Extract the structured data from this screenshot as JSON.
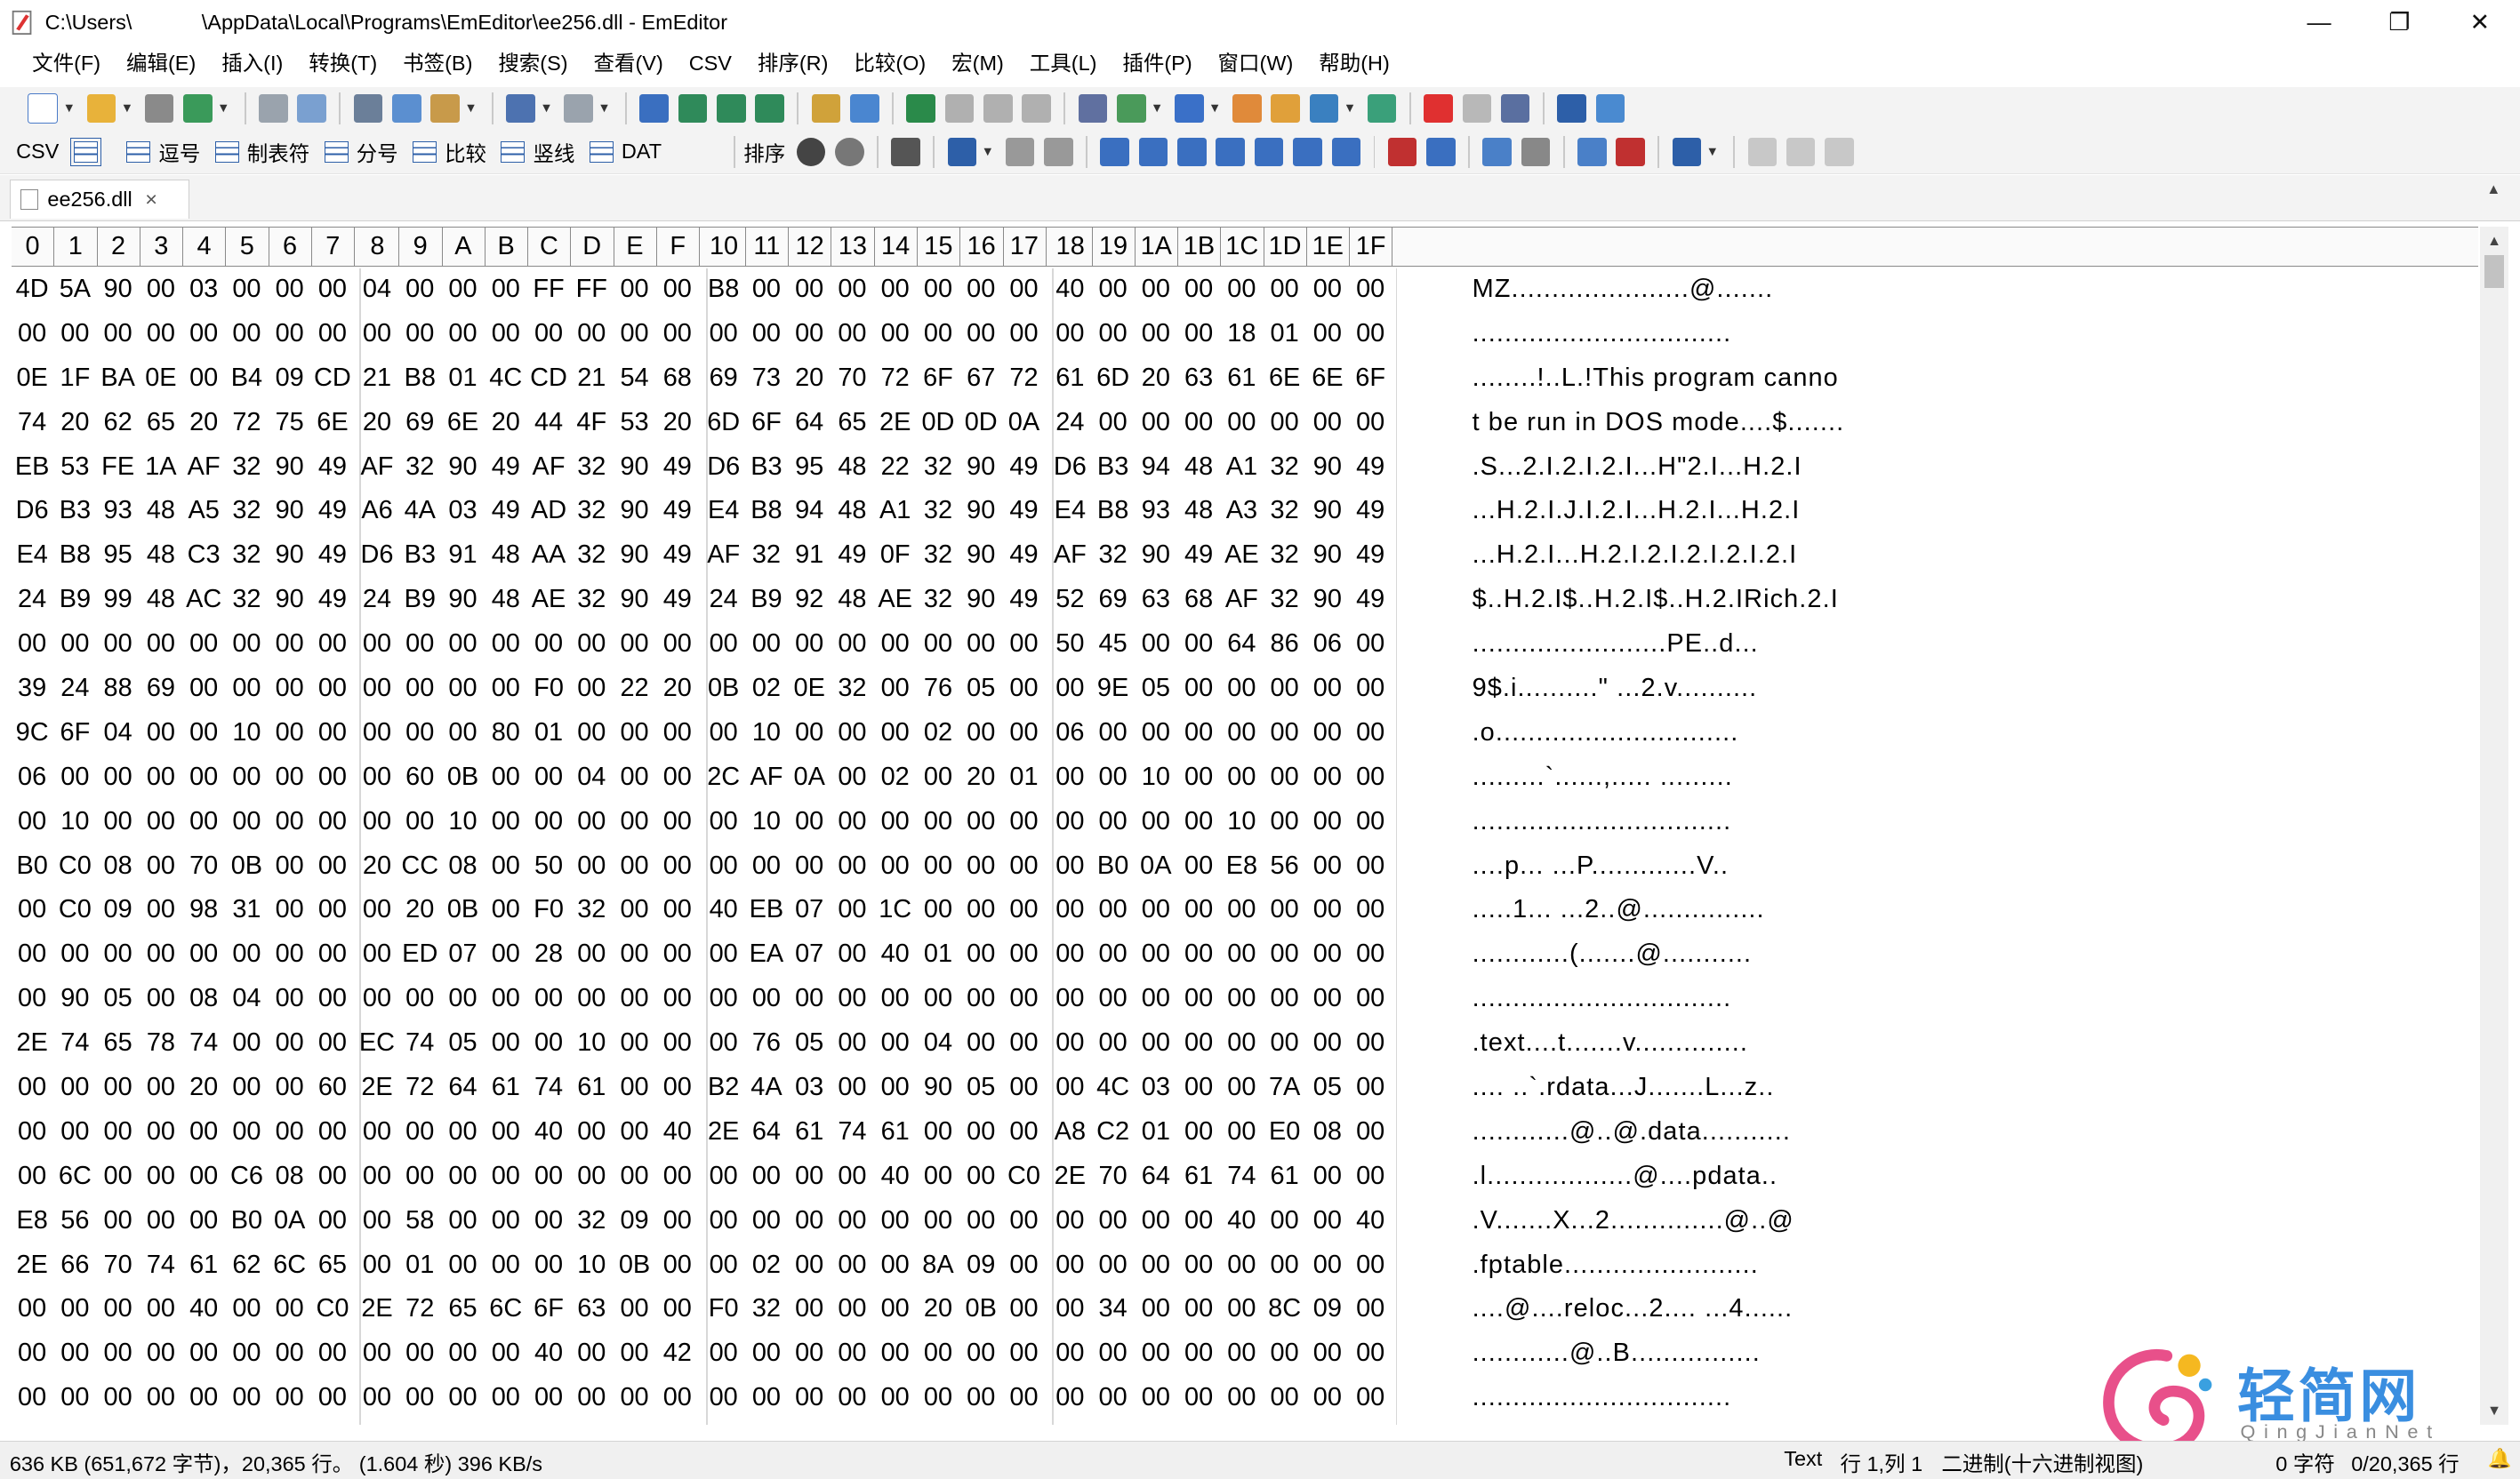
{
  "window": {
    "title": "C:\\Users\\            \\AppData\\Local\\Programs\\EmEditor\\ee256.dll - EmEditor",
    "minimize": "—",
    "restore": "❐",
    "close": "✕"
  },
  "menu": [
    "文件(F)",
    "编辑(E)",
    "插入(I)",
    "转换(T)",
    "书签(B)",
    "搜索(S)",
    "查看(V)",
    "CSV",
    "排序(R)",
    "比较(O)",
    "宏(M)",
    "工具(L)",
    "插件(P)",
    "窗口(W)",
    "帮助(H)"
  ],
  "csv_toolbar": {
    "csv_label": "CSV",
    "buttons": [
      "逗号",
      "制表符",
      "分号",
      "比较",
      "竖线",
      "DAT"
    ],
    "sort_label": "排序"
  },
  "tab": {
    "label": "ee256.dll",
    "close": "×"
  },
  "ruler": [
    "0",
    "1",
    "2",
    "3",
    "4",
    "5",
    "6",
    "7",
    "8",
    "9",
    "A",
    "B",
    "C",
    "D",
    "E",
    "F",
    "10",
    "11",
    "12",
    "13",
    "14",
    "15",
    "16",
    "17",
    "18",
    "19",
    "1A",
    "1B",
    "1C",
    "1D",
    "1E",
    "1F"
  ],
  "rows": [
    {
      "hex": "4D 5A 90 00 03 00 00 00 04 00 00 00 FF FF 00 00 B8 00 00 00 00 00 00 00 40 00 00 00 00 00 00 00",
      "ascii": "MZ......................@......."
    },
    {
      "hex": "00 00 00 00 00 00 00 00 00 00 00 00 00 00 00 00 00 00 00 00 00 00 00 00 00 00 00 00 18 01 00 00",
      "ascii": "................................"
    },
    {
      "hex": "0E 1F BA 0E 00 B4 09 CD 21 B8 01 4C CD 21 54 68 69 73 20 70 72 6F 67 72 61 6D 20 63 61 6E 6E 6F",
      "ascii": "........!..L.!This program canno"
    },
    {
      "hex": "74 20 62 65 20 72 75 6E 20 69 6E 20 44 4F 53 20 6D 6F 64 65 2E 0D 0D 0A 24 00 00 00 00 00 00 00",
      "ascii": "t be run in DOS mode....$......."
    },
    {
      "hex": "EB 53 FE 1A AF 32 90 49 AF 32 90 49 AF 32 90 49 D6 B3 95 48 22 32 90 49 D6 B3 94 48 A1 32 90 49",
      "ascii": ".S...2.I.2.I.2.I...H\"2.I...H.2.I"
    },
    {
      "hex": "D6 B3 93 48 A5 32 90 49 A6 4A 03 49 AD 32 90 49 E4 B8 94 48 A1 32 90 49 E4 B8 93 48 A3 32 90 49",
      "ascii": "...H.2.I.J.I.2.I...H.2.I...H.2.I"
    },
    {
      "hex": "E4 B8 95 48 C3 32 90 49 D6 B3 91 48 AA 32 90 49 AF 32 91 49 0F 32 90 49 AF 32 90 49 AE 32 90 49",
      "ascii": "...H.2.I...H.2.I.2.I.2.I.2.I.2.I"
    },
    {
      "hex": "24 B9 99 48 AC 32 90 49 24 B9 90 48 AE 32 90 49 24 B9 92 48 AE 32 90 49 52 69 63 68 AF 32 90 49",
      "ascii": "$..H.2.I$..H.2.I$..H.2.IRich.2.I"
    },
    {
      "hex": "00 00 00 00 00 00 00 00 00 00 00 00 00 00 00 00 00 00 00 00 00 00 00 00 50 45 00 00 64 86 06 00",
      "ascii": "........................PE..d..."
    },
    {
      "hex": "39 24 88 69 00 00 00 00 00 00 00 00 F0 00 22 20 0B 02 0E 32 00 76 05 00 00 9E 05 00 00 00 00 00",
      "ascii": "9$.i..........\" ...2.v.........."
    },
    {
      "hex": "9C 6F 04 00 00 10 00 00 00 00 00 80 01 00 00 00 00 10 00 00 00 02 00 00 06 00 00 00 00 00 00 00",
      "ascii": ".o.............................."
    },
    {
      "hex": "06 00 00 00 00 00 00 00 00 60 0B 00 00 04 00 00 2C AF 0A 00 02 00 20 01 00 00 10 00 00 00 00 00",
      "ascii": ".........`......,..... ........."
    },
    {
      "hex": "00 10 00 00 00 00 00 00 00 00 10 00 00 00 00 00 00 10 00 00 00 00 00 00 00 00 00 00 10 00 00 00",
      "ascii": "................................"
    },
    {
      "hex": "B0 C0 08 00 70 0B 00 00 20 CC 08 00 50 00 00 00 00 00 00 00 00 00 00 00 00 B0 0A 00 E8 56 00 00",
      "ascii": "....p... ...P.............V.."
    },
    {
      "hex": "00 C0 09 00 98 31 00 00 00 20 0B 00 F0 32 00 00 40 EB 07 00 1C 00 00 00 00 00 00 00 00 00 00 00",
      "ascii": ".....1... ...2..@..............."
    },
    {
      "hex": "00 00 00 00 00 00 00 00 00 ED 07 00 28 00 00 00 00 EA 07 00 40 01 00 00 00 00 00 00 00 00 00 00",
      "ascii": "............(.......@..........."
    },
    {
      "hex": "00 90 05 00 08 04 00 00 00 00 00 00 00 00 00 00 00 00 00 00 00 00 00 00 00 00 00 00 00 00 00 00",
      "ascii": "................................"
    },
    {
      "hex": "2E 74 65 78 74 00 00 00 EC 74 05 00 00 10 00 00 00 76 05 00 00 04 00 00 00 00 00 00 00 00 00 00",
      "ascii": ".text....t.......v.............."
    },
    {
      "hex": "00 00 00 00 20 00 00 60 2E 72 64 61 74 61 00 00 B2 4A 03 00 00 90 05 00 00 4C 03 00 00 7A 05 00",
      "ascii": ".... ..`.rdata...J.......L...z.."
    },
    {
      "hex": "00 00 00 00 00 00 00 00 00 00 00 00 40 00 00 40 2E 64 61 74 61 00 00 00 A8 C2 01 00 00 E0 08 00",
      "ascii": "............@..@.data..........."
    },
    {
      "hex": "00 6C 00 00 00 C6 08 00 00 00 00 00 00 00 00 00 00 00 00 00 40 00 00 C0 2E 70 64 61 74 61 00 00",
      "ascii": ".l..................@....pdata.."
    },
    {
      "hex": "E8 56 00 00 00 B0 0A 00 00 58 00 00 00 32 09 00 00 00 00 00 00 00 00 00 00 00 00 00 40 00 00 40",
      "ascii": ".V.......X...2..............@..@"
    },
    {
      "hex": "2E 66 70 74 61 62 6C 65 00 01 00 00 00 10 0B 00 00 02 00 00 00 8A 09 00 00 00 00 00 00 00 00 00",
      "ascii": ".fptable........................"
    },
    {
      "hex": "00 00 00 00 40 00 00 C0 2E 72 65 6C 6F 63 00 00 F0 32 00 00 00 20 0B 00 00 34 00 00 00 8C 09 00",
      "ascii": "....@....reloc...2.... ...4......"
    },
    {
      "hex": "00 00 00 00 00 00 00 00 00 00 00 00 40 00 00 42 00 00 00 00 00 00 00 00 00 00 00 00 00 00 00 00",
      "ascii": "............@..B................"
    },
    {
      "hex": "00 00 00 00 00 00 00 00 00 00 00 00 00 00 00 00 00 00 00 00 00 00 00 00 00 00 00 00 00 00 00 00",
      "ascii": "................................"
    }
  ],
  "status": {
    "info": "636 KB (651,672 字节)，20,365 行。 (1.604 秒) 396 KB/s",
    "mode": "Text",
    "position": "行 1,列 1",
    "view": "二进制(十六进制视图)",
    "chars": "0 字符",
    "lines": "0/20,365 行"
  },
  "watermark": {
    "name": "轻简网",
    "latin": "Q i n g J i a n N e t"
  },
  "colors": {
    "accent": "#2d5fa8",
    "toolbar_bg": "#f3f3f3",
    "record": "#e03030"
  }
}
